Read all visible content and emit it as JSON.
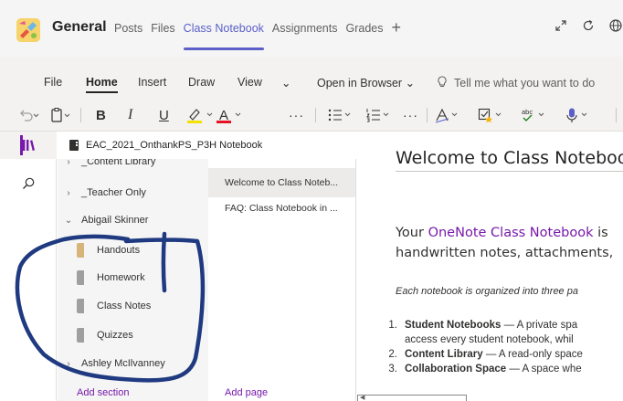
{
  "header": {
    "channel": "General",
    "tabs": [
      "Posts",
      "Files",
      "Class Notebook",
      "Assignments",
      "Grades"
    ],
    "active_tab": "Class Notebook",
    "icons": [
      "expand-icon",
      "refresh-icon",
      "globe-icon"
    ]
  },
  "ribbon": {
    "tabs": [
      "File",
      "Home",
      "Insert",
      "Draw",
      "View",
      "⌄",
      "Open in Browser ⌄"
    ],
    "active_tab": "Home",
    "tell_me": "Tell me what you want to do",
    "tools": {
      "bold": "B",
      "italic": "I",
      "underline": "U",
      "font_color": "A",
      "more": "···",
      "spelling": "abc"
    }
  },
  "notebook": {
    "title": "EAC_2021_OnthankPS_P3H Notebook"
  },
  "sections": {
    "items": [
      {
        "label": "_Content Library",
        "type": "group",
        "chevron": "›"
      },
      {
        "label": "_Teacher Only",
        "type": "group",
        "chevron": "›"
      },
      {
        "label": "Abigail Skinner",
        "type": "group",
        "chevron": "⌄"
      },
      {
        "label": "Handouts",
        "type": "section"
      },
      {
        "label": "Homework",
        "type": "section"
      },
      {
        "label": "Class Notes",
        "type": "section"
      },
      {
        "label": "Quizzes",
        "type": "section"
      },
      {
        "label": "Ashley McIlvanney",
        "type": "group",
        "chevron": "›"
      }
    ],
    "add_label": "Add section"
  },
  "pages": {
    "items": [
      "Welcome to Class Noteb...",
      "FAQ: Class Notebook in ..."
    ],
    "active_index": 0,
    "add_label": "Add page"
  },
  "page": {
    "title": "Welcome to Class Noteboo",
    "intro_prefix": "Your ",
    "intro_link": "OneNote Class Notebook",
    "intro_suffix": " is",
    "intro_line2": "handwritten notes, attachments,",
    "italic": "Each notebook is organized into three pa",
    "list": [
      {
        "num": "1.",
        "bold": "Student Notebooks",
        "text": " — A private spa",
        "cont": "access every student notebook, whil"
      },
      {
        "num": "2.",
        "bold": "Content Library",
        "text": " — A read-only space"
      },
      {
        "num": "3.",
        "bold": "Collaboration Space",
        "text": " —  A space whe"
      }
    ]
  },
  "colors": {
    "accent": "#5b5fc7",
    "onenote_purple": "#7719aa",
    "ink": "#1f3a80",
    "handouts_swatch": "#d7b47a",
    "section_swatch": "#a19f9d"
  }
}
